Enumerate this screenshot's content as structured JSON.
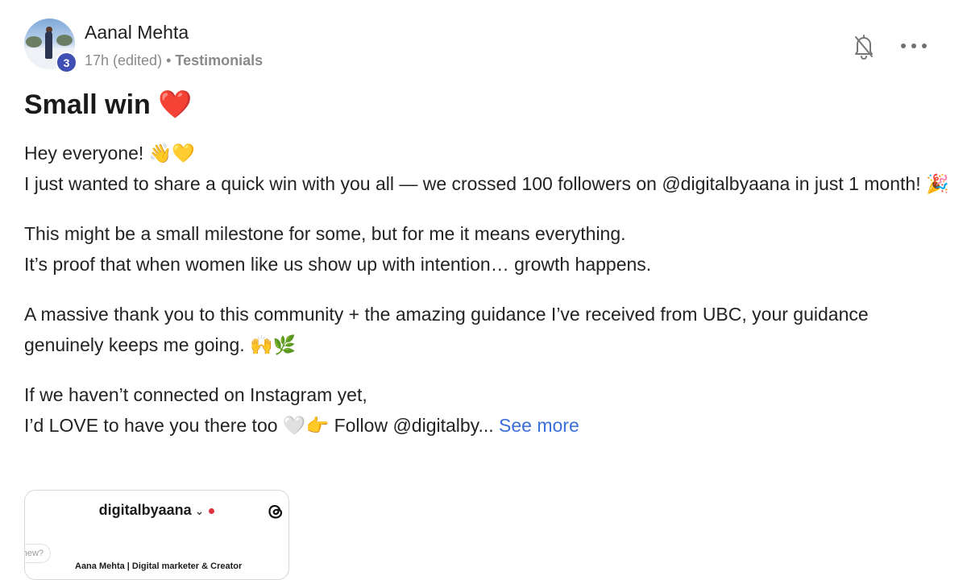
{
  "post": {
    "author": {
      "name": "Aanal Mehta",
      "level": "3"
    },
    "meta": {
      "time": "17h (edited)",
      "separator": "•",
      "category": "Testimonials"
    },
    "title": "Small win ❤️",
    "paragraphs": [
      {
        "line1": "Hey everyone! 👋💛",
        "line2": "I just wanted to share a quick win with you all — we crossed 100 followers on @digitalbyaana in just 1 month! 🎉"
      },
      {
        "line1": "This might be a small milestone for some, but for me it means everything.",
        "line2": "It’s proof that when women like us show up with intention… growth happens."
      },
      {
        "line1": "A massive thank you to this community + the amazing guidance I’ve received from UBC, your guidance genuinely keeps me going. 🙌🌿"
      },
      {
        "line1": "If we haven’t connected on Instagram yet,",
        "line2": "I’d LOVE to have you there too 🤍👉 Follow @digitalby..."
      }
    ],
    "see_more_label": "See more",
    "attachment": {
      "handle": "digitalbyaana",
      "chevron": "⌄",
      "bubble_text": "new?",
      "bio": "Aana Mehta | Digital marketer & Creator"
    }
  },
  "icons": {
    "bell": "bell-off-icon",
    "more": "more-horizontal-icon",
    "threads": "threads-icon"
  }
}
